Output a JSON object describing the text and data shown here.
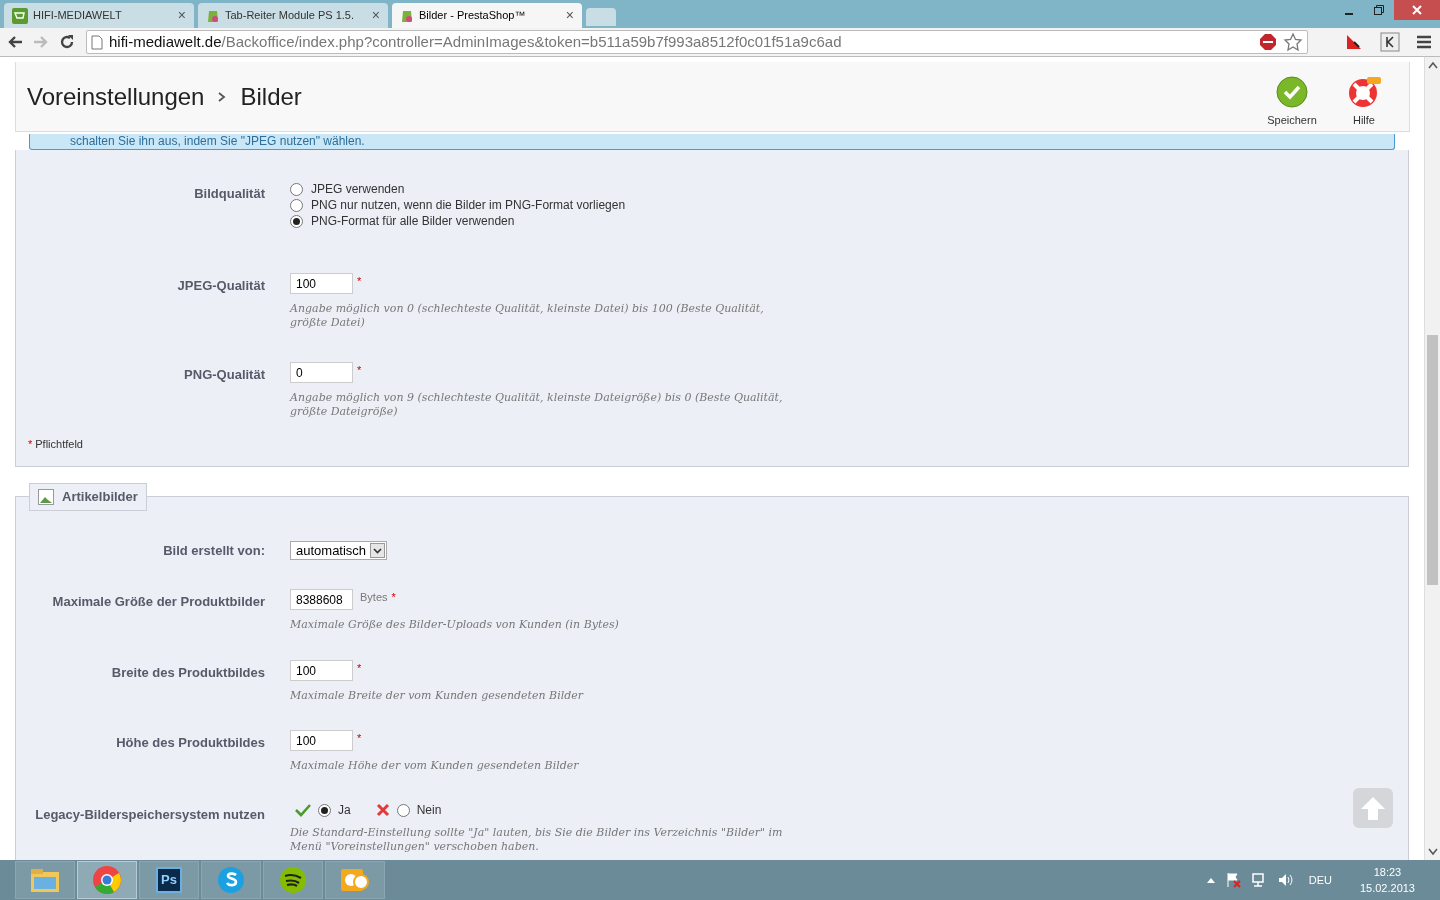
{
  "browser": {
    "tabs": [
      {
        "title": "HIFI-MEDIAWELT",
        "selected": false,
        "close": "×"
      },
      {
        "title": "Tab-Reiter Module PS 1.5.",
        "selected": false,
        "close": "×"
      },
      {
        "title": "Bilder - PrestaShop™",
        "selected": true,
        "close": "×"
      }
    ],
    "address": {
      "host": "hifi-mediawelt.de",
      "path": "/Backoffice/index.php?controller=AdminImages&token=b511a59b7f993a8512f0c01f51a9c6ad"
    }
  },
  "header": {
    "breadcrumb": [
      "Voreinstellungen",
      "Bilder"
    ],
    "toolbar": [
      {
        "kind": "save",
        "label": "Speichern"
      },
      {
        "kind": "help",
        "label": "Hilfe"
      }
    ]
  },
  "info_text": "schalten Sie ihn aus, indem Sie \"JPEG nutzen\" wählen.",
  "panel_1": {
    "fields": [
      {
        "kind": "radio_group",
        "label": "Bildqualität",
        "options": [
          {
            "label": "JPEG verwenden",
            "selected": false
          },
          {
            "label": "PNG nur nutzen, wenn die Bilder im PNG-Format vorliegen",
            "selected": false
          },
          {
            "label": "PNG-Format für alle Bilder verwenden",
            "selected": true
          }
        ]
      },
      {
        "kind": "text",
        "label": "JPEG-Qualität",
        "value": "100",
        "required": "*",
        "hint": "Angabe möglich von 0 (schlechteste Qualität, kleinste Datei) bis 100 (Beste Qualität, größte Datei)"
      },
      {
        "kind": "text",
        "label": "PNG-Qualität",
        "value": "0",
        "required": "*",
        "hint": "Angabe möglich von 9 (schlechteste Qualität, kleinste Dateigröße) bis 0 (Beste Qualität, größte Dateigröße)"
      }
    ],
    "required_note": {
      "mark": "*",
      "text": "Pflichtfeld"
    }
  },
  "panel_2": {
    "legend": "Artikelbilder",
    "fields": [
      {
        "kind": "select",
        "label": "Bild erstellt von:",
        "value": "automatisch"
      },
      {
        "kind": "text",
        "label": "Maximale Größe der Produktbilder",
        "value": "8388608",
        "unit": "Bytes",
        "required": "*",
        "hint": "Maximale Größe des Bilder-Uploads von Kunden (in Bytes)"
      },
      {
        "kind": "text",
        "label": "Breite des Produktbildes",
        "value": "100",
        "required": "*",
        "hint": "Maximale Breite der vom Kunden gesendeten Bilder"
      },
      {
        "kind": "text",
        "label": "Höhe des Produktbildes",
        "value": "100",
        "required": "*",
        "hint": "Maximale Höhe der vom Kunden gesendeten Bilder"
      },
      {
        "kind": "yesno",
        "label": "Legacy-Bilderspeichersystem nutzen",
        "options": [
          {
            "label": "Ja",
            "selected": true
          },
          {
            "label": "Nein",
            "selected": false
          }
        ],
        "hint": "Die Standard-Einstellung sollte \"Ja\" lauten, bis Sie die Bilder ins Verzeichnis \"Bilder\" im Menü \"Voreinstellungen\" verschoben haben."
      }
    ]
  },
  "taskbar": {
    "apps": [
      {
        "kind": "explorer",
        "selected": false
      },
      {
        "kind": "chrome",
        "selected": true
      },
      {
        "kind": "photoshop",
        "text": "Ps",
        "selected": false
      },
      {
        "kind": "skype",
        "selected": false
      },
      {
        "kind": "spotify",
        "selected": false
      },
      {
        "kind": "outlook",
        "selected": false
      }
    ],
    "tray": {
      "language": "DEU",
      "time": "18:23",
      "date": "15.02.2013"
    }
  }
}
